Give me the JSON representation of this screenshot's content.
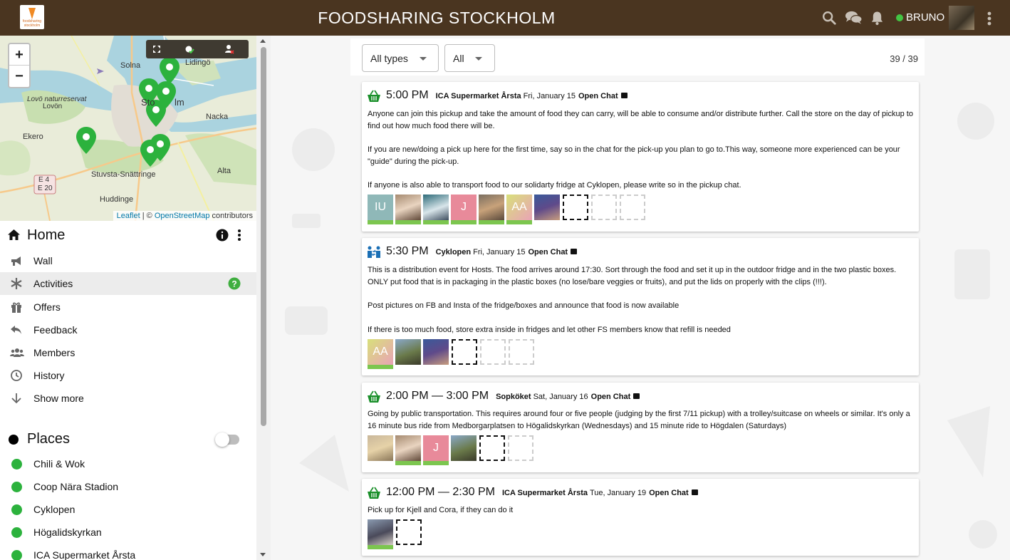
{
  "header": {
    "title": "FOODSHARING STOCKHOLM",
    "logo_text": "foodsharing stockholm",
    "username": "BRUNO"
  },
  "map": {
    "labels": [
      "Solna",
      "Lidingö",
      "Lovö naturreservat",
      "Lovön",
      "Sto",
      "lm",
      "Nacka",
      "Ekero",
      "Stuvsta-Snättringe",
      "Alta",
      "Huddinge",
      "E 4",
      "E 20"
    ],
    "attribution": {
      "leaflet": "Leaflet",
      "sep": " | © ",
      "osm": "OpenStreetMap",
      "rest": " contributors"
    },
    "zoom_in": "+",
    "zoom_out": "−"
  },
  "sidebar": {
    "group_title": "Home",
    "nav": [
      {
        "label": "Wall",
        "icon": "megaphone-icon"
      },
      {
        "label": "Activities",
        "icon": "asterisk-icon",
        "active": true
      },
      {
        "label": "Offers",
        "icon": "gift-icon"
      },
      {
        "label": "Feedback",
        "icon": "reply-icon"
      },
      {
        "label": "Members",
        "icon": "users-icon"
      },
      {
        "label": "History",
        "icon": "clock-icon"
      },
      {
        "label": "Show more",
        "icon": "arrow-down-icon"
      }
    ],
    "places_title": "Places",
    "places": [
      "Chili & Wok",
      "Coop Nära Stadion",
      "Cyklopen",
      "Högalidskyrkan",
      "ICA Supermarket Årsta"
    ]
  },
  "filters": {
    "type": "All types",
    "slots": "All",
    "count": "39 / 39"
  },
  "activities": [
    {
      "icon": "basket-icon",
      "time": "5:00 PM",
      "place": "ICA Supermarket Årsta",
      "date": "Fri, January 15",
      "chat": "Open Chat",
      "paragraphs": [
        "Anyone can join this pickup and take the amount of food they can carry, will be able to consume and/or distribute further. Call the store on the day of pickup to find out how much food there will be.",
        "If you are new/doing a pick up here for the first time, say so in the chat for the pick-up you plan to go to.This way, someone more experienced can be your \"guide\" during the pick-up.",
        "If anyone is also able to transport food to our solidarty fridge at Cyklopen, please write so in the pickup chat."
      ]
    },
    {
      "icon": "distribution-icon",
      "time": "5:30 PM",
      "place": "Cyklopen",
      "date": "Fri, January 15",
      "chat": "Open Chat",
      "paragraphs": [
        "This is a distribution event for Hosts. The food arrives around 17:30. Sort through the food and set it up in the outdoor fridge and in the two plastic boxes. ONLY put food that is in packaging in the plastic boxes (no lose/bare veggies or fruits), and put the lids on properly with the clips (!!!).",
        "Post pictures on FB and Insta of the fridge/boxes and announce that food is now available",
        "If there is too much food, store extra inside in fridges and let other FS members know that refill is needed"
      ]
    },
    {
      "icon": "basket-icon",
      "time": "2:00 PM — 3:00 PM",
      "place": "Sopköket",
      "date": "Sat, January 16",
      "chat": "Open Chat",
      "paragraphs": [
        "Going by public transportation. This requires around four or five people (judging by the first 7/11 pickup) with a trolley/suitcase on wheels or similar. It's only a 16 minute bus ride from Medborgarplatsen to Högalidskyrkan (Wednesdays) and 15 minute ride to Högdalen (Saturdays)"
      ]
    },
    {
      "icon": "basket-icon",
      "time": "12:00 PM — 2:30 PM",
      "place": "ICA Supermarket Årsta",
      "date": "Tue, January 19",
      "chat": "Open Chat",
      "paragraphs": [
        "Pick up for Kjell and Cora, if they can do it"
      ]
    }
  ],
  "avatars": {
    "a1": [
      "IU",
      "",
      "",
      "J",
      "",
      "AA",
      ""
    ],
    "a2": [
      "AA",
      "",
      ""
    ],
    "a3": [
      "",
      "",
      "J",
      ""
    ],
    "a4": [
      ""
    ]
  },
  "colors": {
    "header_bg": "#4a3520",
    "accent_green": "#2cb23d",
    "online": "#43c443",
    "slot_bar": "#7cc64f"
  }
}
